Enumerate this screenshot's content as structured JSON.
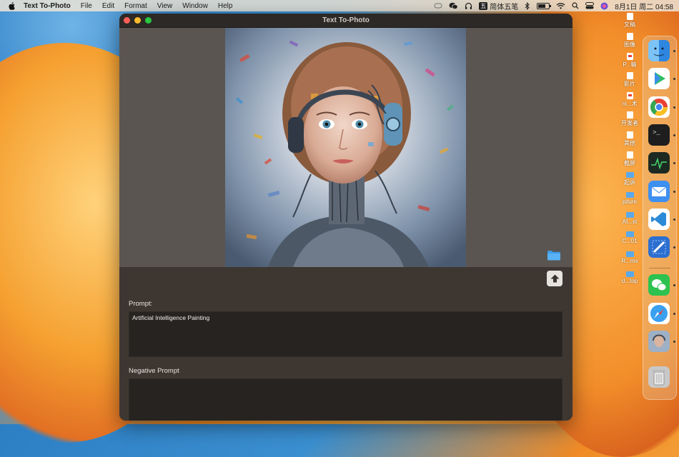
{
  "menubar": {
    "app_name": "Text To-Photo",
    "items": [
      "File",
      "Edit",
      "Format",
      "View",
      "Window",
      "Help"
    ],
    "ime_badge": "五",
    "ime_label": "简体五笔",
    "datetime": "8月1日 周二 04:58"
  },
  "window": {
    "title": "Text To-Photo"
  },
  "prompt": {
    "label": "Prompt:",
    "value": "Artificial Intelligence Painting"
  },
  "negative_prompt": {
    "label": "Negative Prompt",
    "value": ""
  },
  "desktop_items": [
    {
      "label": "文稿",
      "icon": "document-icon"
    },
    {
      "label": "图像",
      "icon": "document-icon"
    },
    {
      "label": "P...稿",
      "icon": "pdf-icon"
    },
    {
      "label": "影片",
      "icon": "document-icon"
    },
    {
      "label": "nl...术",
      "icon": "pdf-icon"
    },
    {
      "label": "开发者",
      "icon": "document-icon"
    },
    {
      "label": "其他",
      "icon": "document-icon"
    },
    {
      "label": "截屏",
      "icon": "document-icon"
    },
    {
      "label": "起诉",
      "icon": "folder-icon"
    },
    {
      "label": "piture",
      "icon": "folder-icon"
    },
    {
      "label": "AI...st",
      "icon": "folder-icon"
    },
    {
      "label": "C...01",
      "icon": "folder-icon"
    },
    {
      "label": "R...ms",
      "icon": "folder-icon"
    },
    {
      "label": "d...top",
      "icon": "folder-icon"
    }
  ],
  "dock_apps": [
    {
      "name": "finder-icon",
      "color": "#4aa3f0"
    },
    {
      "name": "play-store-icon",
      "color": "#ffffff"
    },
    {
      "name": "chrome-icon",
      "color": "#ffffff"
    },
    {
      "name": "terminal-icon",
      "color": "#1e1e1e"
    },
    {
      "name": "activity-monitor-icon",
      "color": "#1d2a22"
    },
    {
      "name": "mail-icon",
      "color": "#3d8ff0"
    },
    {
      "name": "vscode-icon",
      "color": "#ffffff"
    },
    {
      "name": "xcode-icon",
      "color": "#2d6fd0"
    },
    {
      "name": "wechat-icon",
      "color": "#2dc24f"
    },
    {
      "name": "safari-icon",
      "color": "#ffffff"
    },
    {
      "name": "text-to-photo-icon",
      "color": "#8aa0b8"
    },
    {
      "name": "trash-icon",
      "color": "#c8c8c8"
    }
  ]
}
